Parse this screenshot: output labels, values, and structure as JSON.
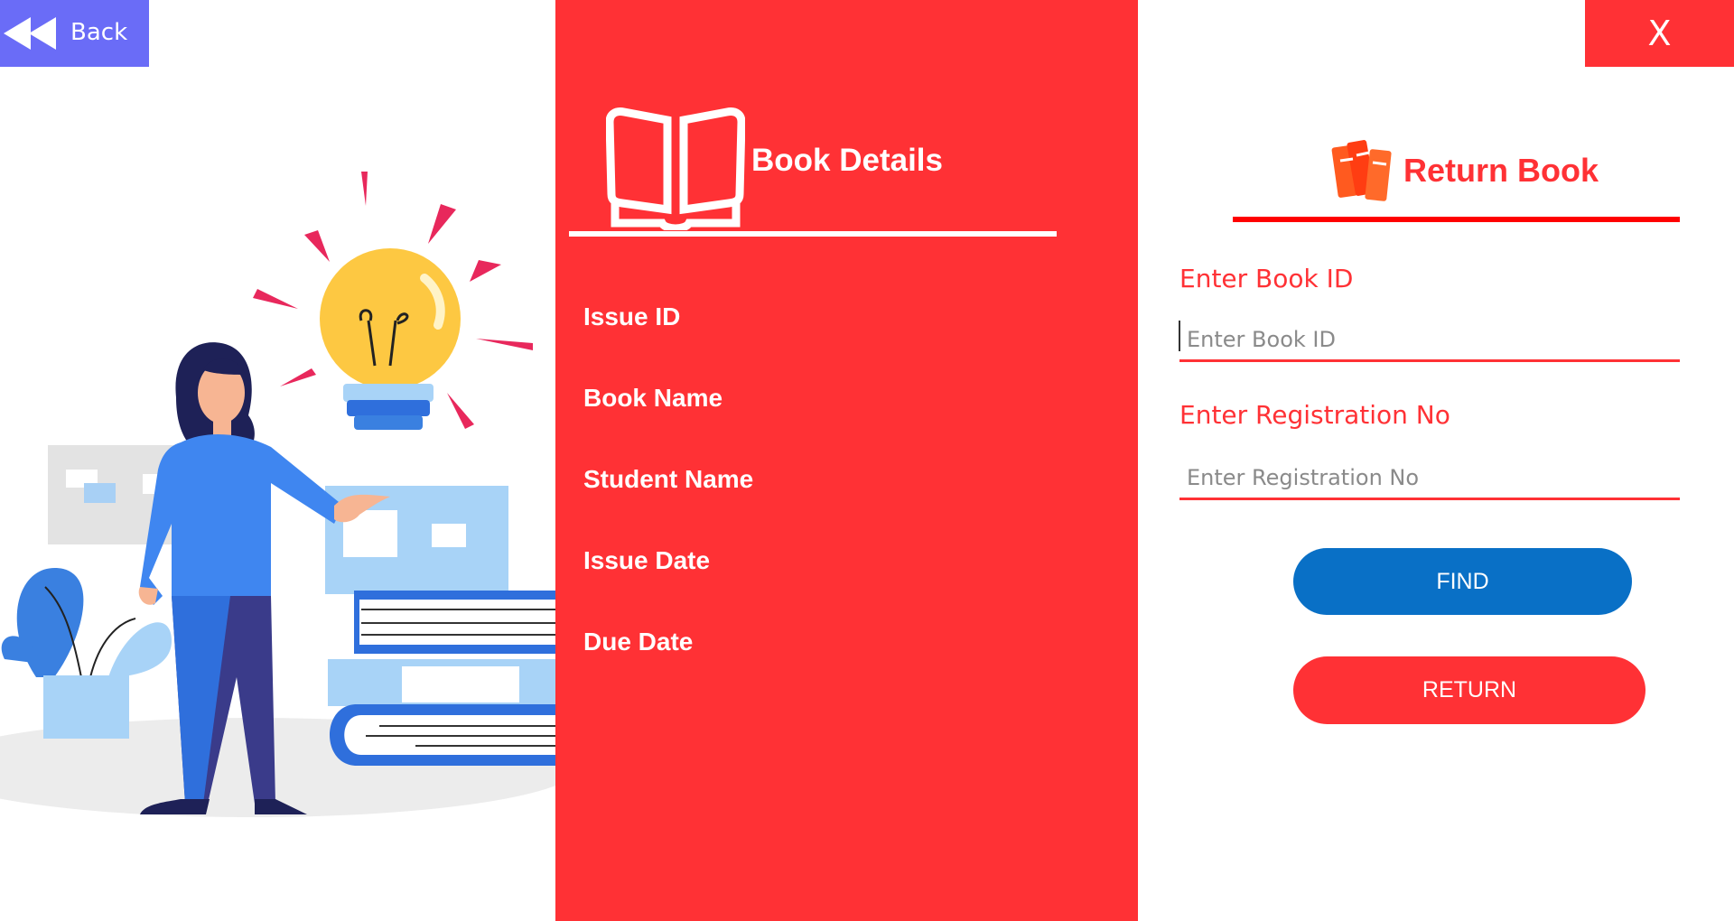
{
  "header": {
    "back_label": "Back",
    "close_label": "X"
  },
  "details": {
    "title": "Book Details",
    "labels": [
      "Issue ID",
      "Book Name",
      "Student Name",
      "Issue Date",
      "Due Date"
    ]
  },
  "form": {
    "title": "Return Book",
    "book_id_label": "Enter Book ID",
    "book_id_placeholder": "Enter Book ID",
    "book_id_value": "",
    "reg_label": "Enter Registration No",
    "reg_placeholder": "Enter Registration No",
    "reg_value": "",
    "find_label": "FIND",
    "return_label": "RETURN"
  },
  "colors": {
    "accent_red": "#ff3135",
    "back_purple": "#6a6cf7",
    "find_blue": "#0970c6",
    "return_icon_orange": "#ff5a1f"
  },
  "icons": [
    "back-arrow-icon",
    "open-book-icon",
    "books-icon"
  ]
}
